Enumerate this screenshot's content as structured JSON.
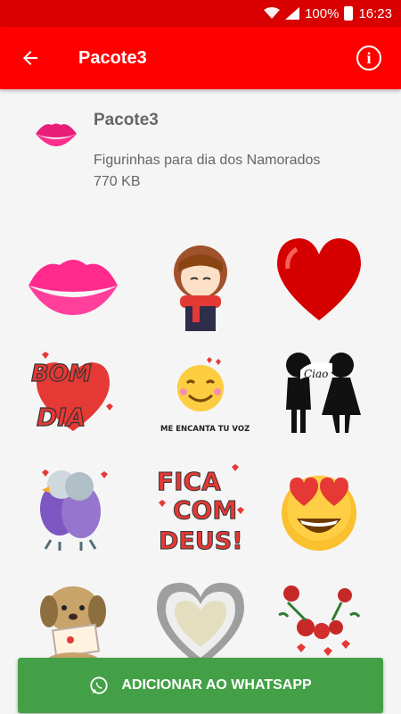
{
  "status_bar": {
    "battery": "100%",
    "time": "16:23"
  },
  "app_bar": {
    "title": "Pacote3",
    "back_icon": "arrow-left-icon",
    "info_icon": "info-icon"
  },
  "pack": {
    "name": "Pacote3",
    "description": "Figurinhas para dia dos Namorados",
    "size": "770 KB"
  },
  "stickers": [
    {
      "name": "lips"
    },
    {
      "name": "girl-scarf"
    },
    {
      "name": "red-heart"
    },
    {
      "name": "bom-dia",
      "line1": "BOM",
      "line2": "DIA"
    },
    {
      "name": "emoji-encanta",
      "text": "ME ENCANTA TU VOZ"
    },
    {
      "name": "silhouette-couple",
      "text": "Ciao"
    },
    {
      "name": "birds-couple"
    },
    {
      "name": "fica-com-deus",
      "line1": "FICA",
      "line2": "COM",
      "line3": "DEUS!"
    },
    {
      "name": "heart-eyes-emoji"
    },
    {
      "name": "puppy-letter"
    },
    {
      "name": "silver-heart"
    },
    {
      "name": "roses-hearts"
    }
  ],
  "action": {
    "label": "ADICIONAR AO WHATSAPP",
    "icon": "whatsapp-icon"
  },
  "colors": {
    "appbar": "#ff0000",
    "statusbar": "#d80000",
    "button": "#43a047"
  }
}
